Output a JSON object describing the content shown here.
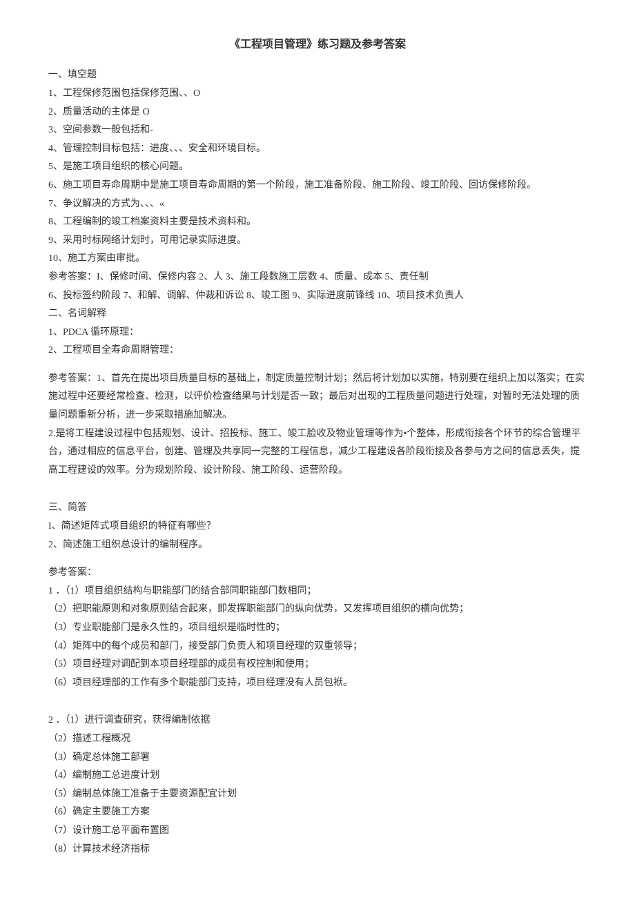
{
  "title": "《工程项目管理》练习题及参考答案",
  "section1": {
    "heading": "一、填空题",
    "items": [
      "1、工程保修范围包括保修范围、、O",
      "2、质量活动的主体是 O",
      "3、空间参数一般包括和-",
      "4、管理控制目标包括：进度、、、安全和环境目标。",
      "5、是施工项目组织的核心问题。",
      "6、施工项目寿命周期中是施工项目寿命周期的第一个阶段，施工准备阶段、施工阶段、竣工阶段、回访保修阶段。",
      "7、争议解决的方式为、、、«",
      "8、工程编制的竣工档案资料主要是技术资料和。",
      "9、采用时标网络计划时，可用记录实际进度。",
      "10、施工方案由审批。"
    ],
    "answers": [
      "参考答案：I、保修时间、保修内容 2、人 3、施工段数施工层数 4、质量、成本 5、责任制",
      "6、投标签约阶段 7、和解、调解、仲裁和诉讼 8、竣工图 9、实际进度前锋线 10、项目技术负责人"
    ]
  },
  "section2": {
    "heading": "二、名词解释",
    "items": [
      "1、PDCA 循环原理：",
      "2、工程项目全寿命周期管理："
    ],
    "answers": [
      "参考答案：1、首先在提出项目质量目标的基础上，制定质量控制计划；然后将计划加以实施，特别要在组织上加以落实；在实施过程中还要经常检查、检测，以评价检查结果与计划是否一致；最后对出现的工程质量问题进行处理，对暂时无法处理的质量问题重新分析，进一步采取措施加解决。",
      "2.是将工程建设过程中包括规划、设计、招投标、施工、竣工脸收及物业管理等作为•个整体，形成衔接各个环节的综合管理平台，通过相应的信息平台，创建、管理及共享同一完整的工程信息，减少工程建设各阶段衔接及各参与方之间的信息丢失，提高工程建设的效率。分为规划阶段、设计阶段、施工阶段、运营阶段。"
    ]
  },
  "section3": {
    "heading": "三、简答",
    "items": [
      "I、简述矩阵式项目组织的特征有哪些？",
      "2、简述施工组织总设计的编制程序。"
    ],
    "answerLabel": "参考答案：",
    "answer1": [
      "1 ．（1）项目组织结构与职能部门的结合部同职能部门数相同；",
      "（2）把职能原则和对象原则结合起来，即发挥职能部门的纵向优势，又发挥项目组织的横向优势；",
      "（3）专业职能部门是永久性的，项目组织是临时性的；",
      "（4）矩阵中的每个成员和部门，接受部门负责人和项目经理的双重领导；",
      "（5）项目经理对调配到本项目经理部的成员有权控制和使用；",
      "（6）项目经理部的工作有多个职能部门支持，项目经理没有人员包袱。"
    ],
    "answer2": [
      "2 ．（1）进行调查研究，获得编制依据",
      "（2）描述工程概况",
      "（3）确定总体施工部署",
      "（4）编制施工总进度计划",
      "（5）编制总体施工准备于主要资源配宜计划",
      "（6）确定主要施工方案",
      "（7）设计施工总平面布置图",
      "（8）计算技术经济指标"
    ]
  }
}
